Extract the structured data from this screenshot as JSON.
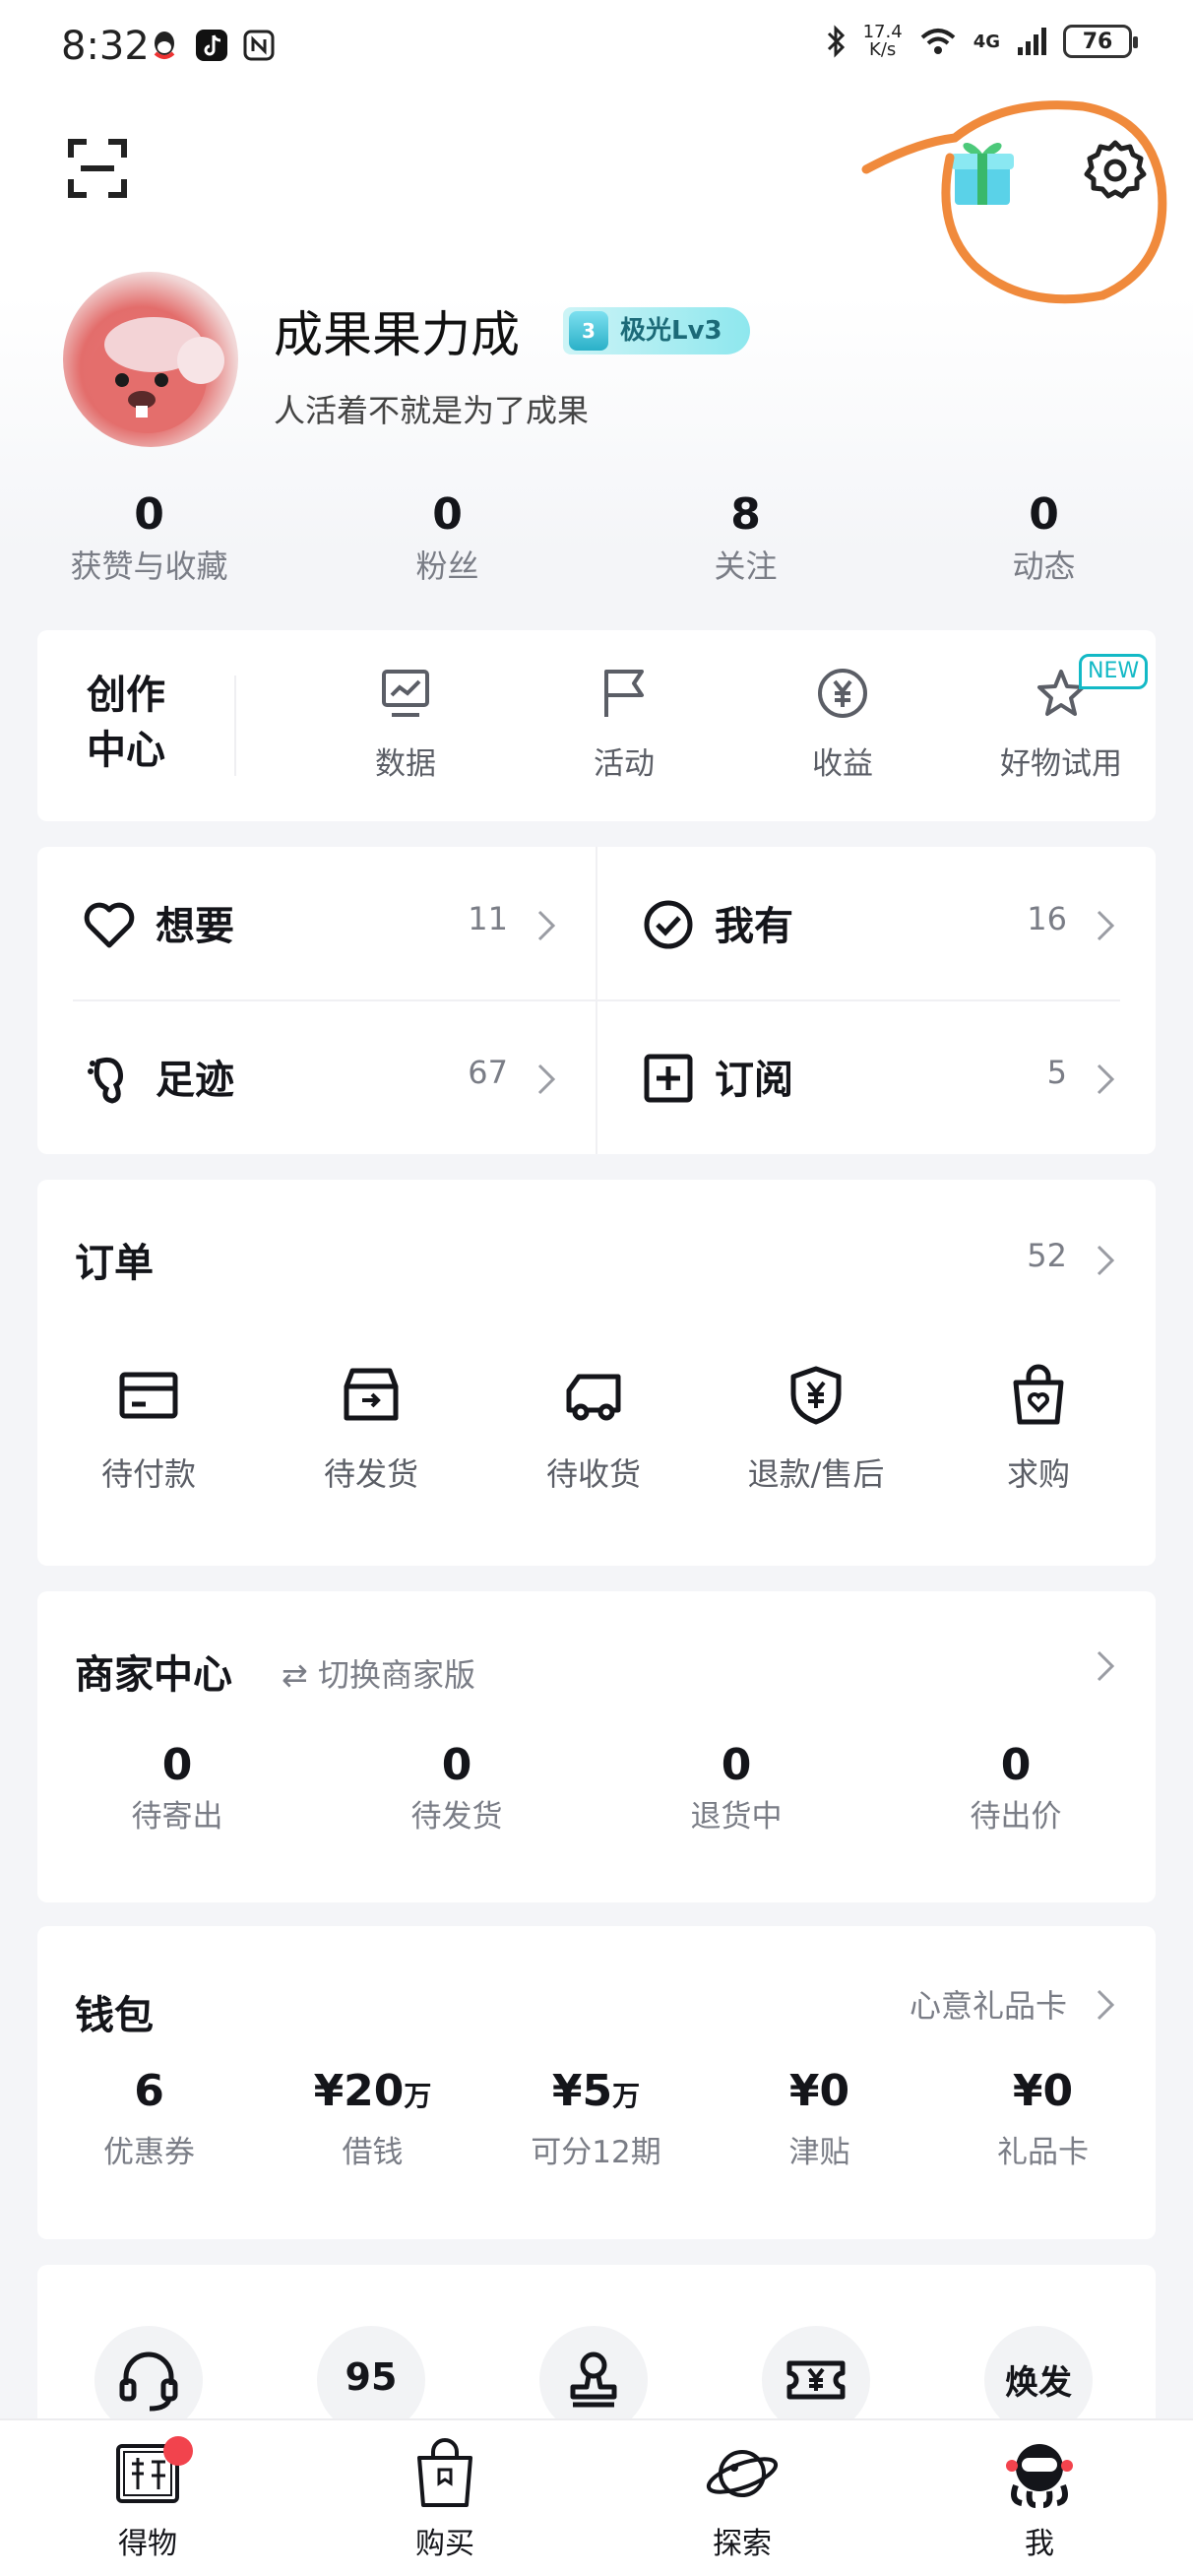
{
  "status_bar": {
    "time": "8:32",
    "net_speed": "17.4",
    "net_unit": "K/s",
    "network": "4G",
    "battery": "76"
  },
  "profile": {
    "nickname": "成果果力成",
    "level_num": "3",
    "level_label": "极光Lv3",
    "bio": "人活着不就是为了成果"
  },
  "stats": [
    {
      "value": "0",
      "label": "获赞与收藏"
    },
    {
      "value": "0",
      "label": "粉丝"
    },
    {
      "value": "8",
      "label": "关注"
    },
    {
      "value": "0",
      "label": "动态"
    }
  ],
  "creator": {
    "title": "创作中心",
    "items": [
      {
        "label": "数据",
        "icon": "chart-monitor-icon"
      },
      {
        "label": "活动",
        "icon": "flag-icon"
      },
      {
        "label": "收益",
        "icon": "yuan-coin-icon"
      },
      {
        "label": "好物试用",
        "icon": "star-icon",
        "tag": "NEW"
      }
    ]
  },
  "collections": [
    {
      "label": "想要",
      "count": "11",
      "icon": "heart-icon"
    },
    {
      "label": "我有",
      "count": "16",
      "icon": "check-circle-icon"
    },
    {
      "label": "足迹",
      "count": "67",
      "icon": "footprint-icon"
    },
    {
      "label": "订阅",
      "count": "5",
      "icon": "plus-square-icon"
    }
  ],
  "orders": {
    "title": "订单",
    "count": "52",
    "items": [
      {
        "label": "待付款",
        "icon": "card-icon"
      },
      {
        "label": "待发货",
        "icon": "box-icon"
      },
      {
        "label": "待收货",
        "icon": "truck-icon"
      },
      {
        "label": "退款/售后",
        "icon": "shield-yuan-icon"
      },
      {
        "label": "求购",
        "icon": "bag-heart-icon"
      }
    ]
  },
  "merchant": {
    "title": "商家中心",
    "switch_label": "⇄ 切换商家版",
    "items": [
      {
        "value": "0",
        "label": "待寄出"
      },
      {
        "value": "0",
        "label": "待发货"
      },
      {
        "value": "0",
        "label": "退货中"
      },
      {
        "value": "0",
        "label": "待出价"
      }
    ]
  },
  "wallet": {
    "title": "钱包",
    "link": "心意礼品卡",
    "items": [
      {
        "value": "6",
        "unit": "",
        "label": "优惠券"
      },
      {
        "value": "¥20",
        "unit": "万",
        "label": "借钱"
      },
      {
        "value": "¥5",
        "unit": "万",
        "label": "可分12期"
      },
      {
        "value": "¥0",
        "unit": "",
        "label": "津贴"
      },
      {
        "value": "¥0",
        "unit": "",
        "label": "礼品卡"
      }
    ]
  },
  "services": [
    {
      "icon": "headset-icon"
    },
    {
      "text": "95"
    },
    {
      "icon": "stamp-icon"
    },
    {
      "icon": "ticket-yuan-icon"
    },
    {
      "text": "焕发"
    }
  ],
  "tabs": [
    {
      "label": "得物",
      "icon": "dewu-logo-icon"
    },
    {
      "label": "购买",
      "icon": "shopping-bag-icon"
    },
    {
      "label": "探索",
      "icon": "planet-icon"
    },
    {
      "label": "我",
      "icon": "astronaut-avatar-icon"
    }
  ],
  "colors": {
    "accent": "#13b9c6",
    "badge": "#f2434d",
    "annotation": "#f08a3c"
  }
}
